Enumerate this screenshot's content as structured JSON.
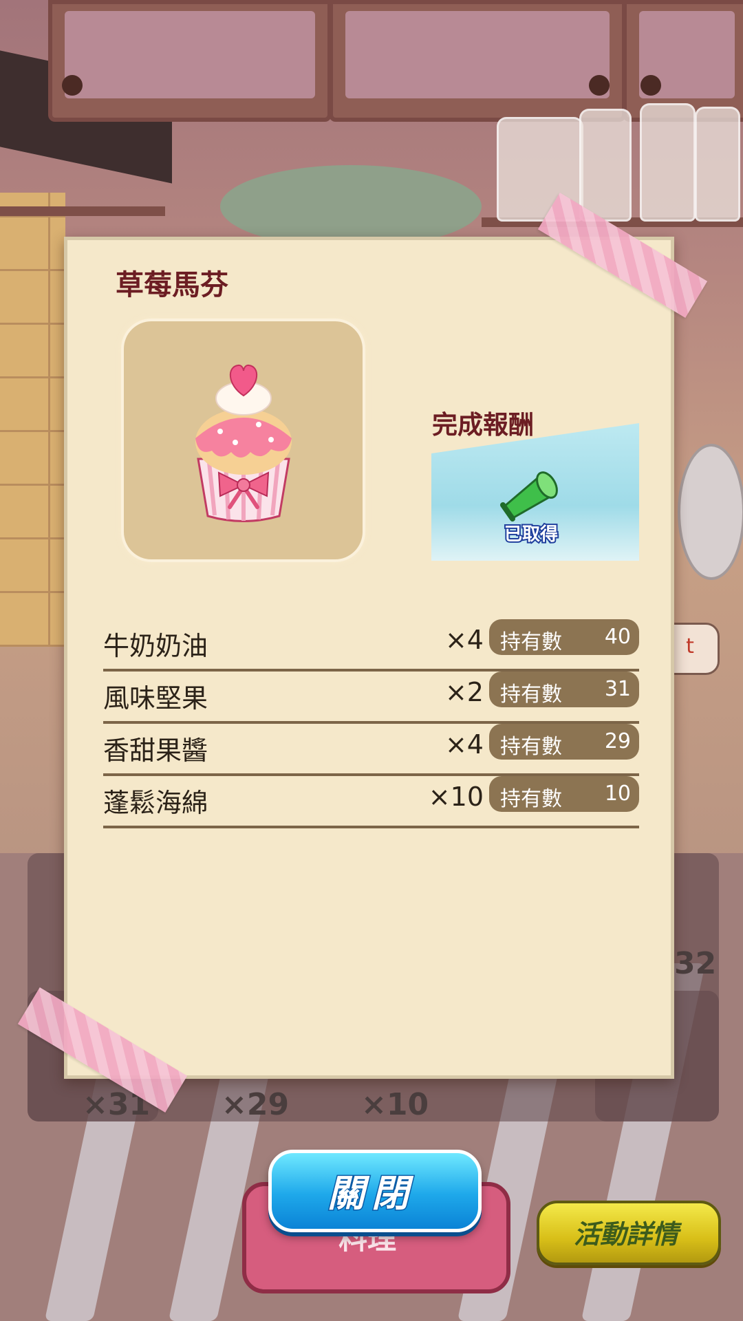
{
  "dialog": {
    "title": "草莓馬芬",
    "item_icon": "strawberry-muffin-icon",
    "reward": {
      "label": "完成報酬",
      "icon": "green-megaphone-icon",
      "status": "已取得"
    },
    "ingredients": [
      {
        "name": "牛奶奶油",
        "required": "×4",
        "owned_label": "持有數",
        "owned": "40"
      },
      {
        "name": "風味堅果",
        "required": "×2",
        "owned_label": "持有數",
        "owned": "31"
      },
      {
        "name": "香甜果醬",
        "required": "×4",
        "owned_label": "持有數",
        "owned": "29"
      },
      {
        "name": "蓬鬆海綿",
        "required": "×10",
        "owned_label": "持有數",
        "owned": "10"
      }
    ]
  },
  "background": {
    "slot_counts": [
      "×31",
      "×29",
      "×10",
      "32"
    ],
    "partial_button_text": "t",
    "cook_button": "料理"
  },
  "buttons": {
    "close": "關閉",
    "event_details": "活動詳情"
  },
  "colors": {
    "title": "#6c1d23",
    "panel": "#f5e8ca",
    "pill": "#8c7452",
    "close_button": "#1ea8ea",
    "event_button": "#d8bf18"
  }
}
